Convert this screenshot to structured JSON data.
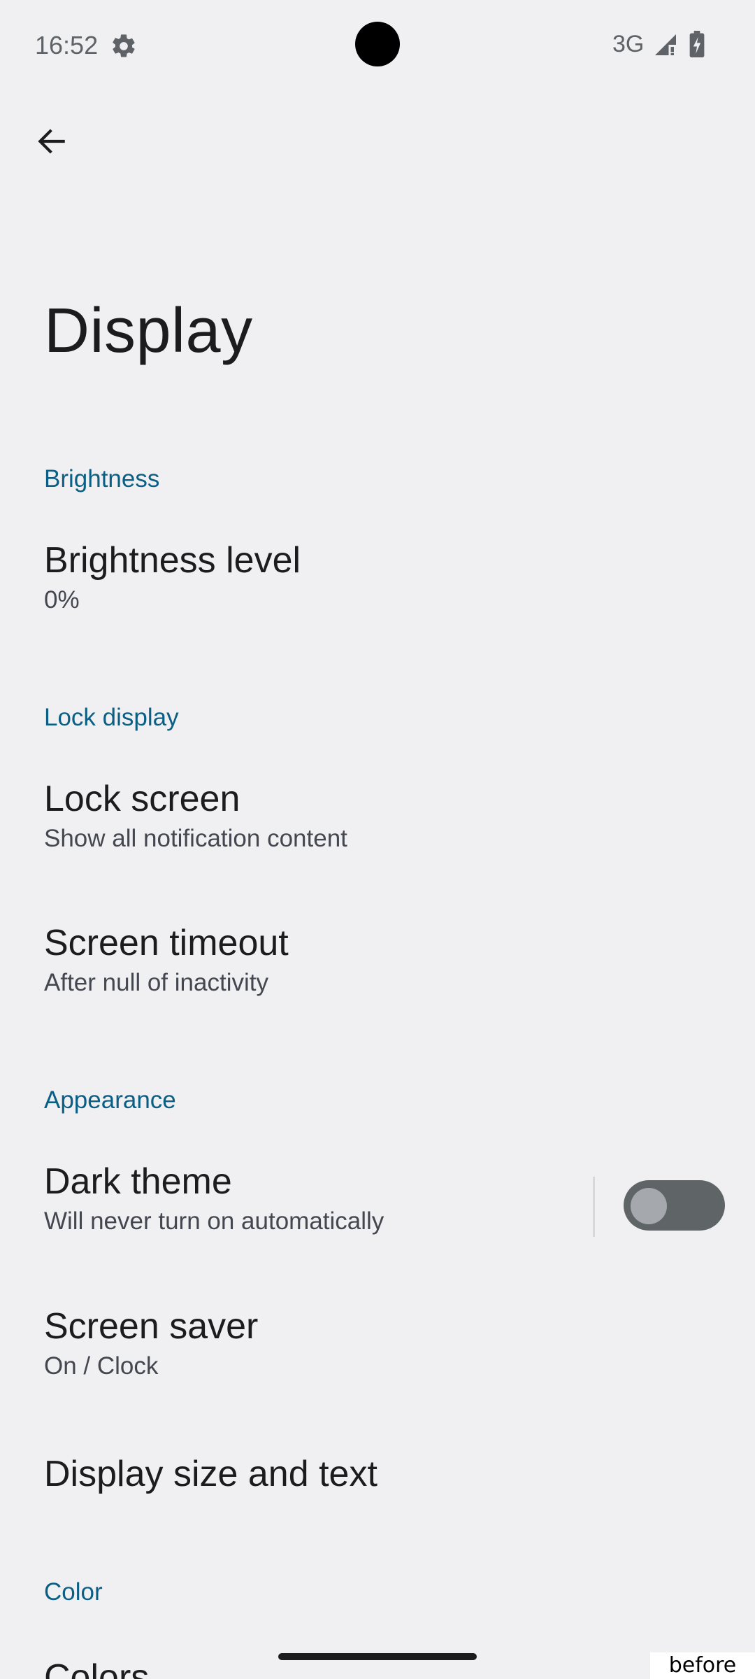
{
  "status_bar": {
    "time": "16:52",
    "network": "3G",
    "icons": [
      "settings-gear-icon",
      "signal-icon",
      "battery-charging-icon"
    ]
  },
  "toolbar": {
    "back_icon": "arrow-back-icon"
  },
  "page": {
    "title": "Display"
  },
  "sections": [
    {
      "category": "Brightness",
      "items": [
        {
          "title": "Brightness level",
          "summary": "0%"
        }
      ]
    },
    {
      "category": "Lock display",
      "items": [
        {
          "title": "Lock screen",
          "summary": "Show all notification content"
        },
        {
          "title": "Screen timeout",
          "summary": "After null of inactivity"
        }
      ]
    },
    {
      "category": "Appearance",
      "items": [
        {
          "title": "Dark theme",
          "summary": "Will never turn on automatically",
          "toggle": false
        },
        {
          "title": "Screen saver",
          "summary": "On / Clock"
        },
        {
          "title": "Display size and text",
          "summary": ""
        }
      ]
    },
    {
      "category": "Color",
      "items": [
        {
          "title": "Colors",
          "summary": ""
        }
      ]
    }
  ],
  "overlay_label": "before",
  "colors": {
    "background": "#f0f0f3",
    "category_accent": "#0b5f84",
    "toggle_track_off": "#5f6567",
    "toggle_thumb_off": "#a5a9ae"
  }
}
